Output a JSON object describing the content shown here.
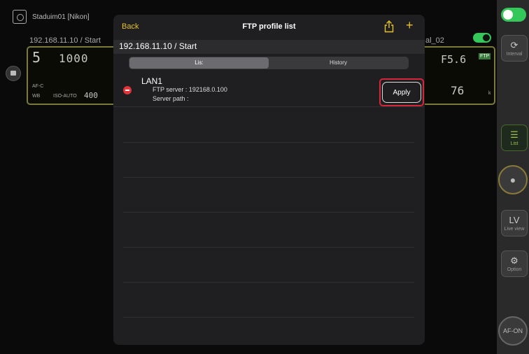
{
  "background": {
    "camera_name": "Staduim01 [Nikon]",
    "ip_left": "192.168.11.10 / Start",
    "ip_right_fragment": "al_02",
    "lcd_left": {
      "shutter_digit": "5",
      "shutter_value": "1000",
      "focus_mode": "AF-C",
      "iso_label": "ISO-AUTO",
      "iso_value": "400",
      "wb_label": "WB"
    },
    "lcd_right": {
      "aperture": "F5.6",
      "ftp_badge": "FTP",
      "frames": "76",
      "frames_unit": "k"
    }
  },
  "sidebar": {
    "interval_label": "Interval",
    "list_label": "List",
    "lv_label": "LV",
    "live_view_label": "Live view",
    "option_label": "Option",
    "af_on_label": "AF-ON"
  },
  "modal": {
    "back_label": "Back",
    "title": "FTP profile list",
    "add_glyph": "+",
    "ip_bar": "192.168.11.10 / Start",
    "tabs": [
      {
        "label": "Lis:",
        "active": true
      },
      {
        "label": "History",
        "active": false
      }
    ],
    "profiles": [
      {
        "name": "LAN1",
        "server": "FTP server : 192168.0.100",
        "path": "Server path :",
        "apply_label": "Apply"
      }
    ]
  }
}
